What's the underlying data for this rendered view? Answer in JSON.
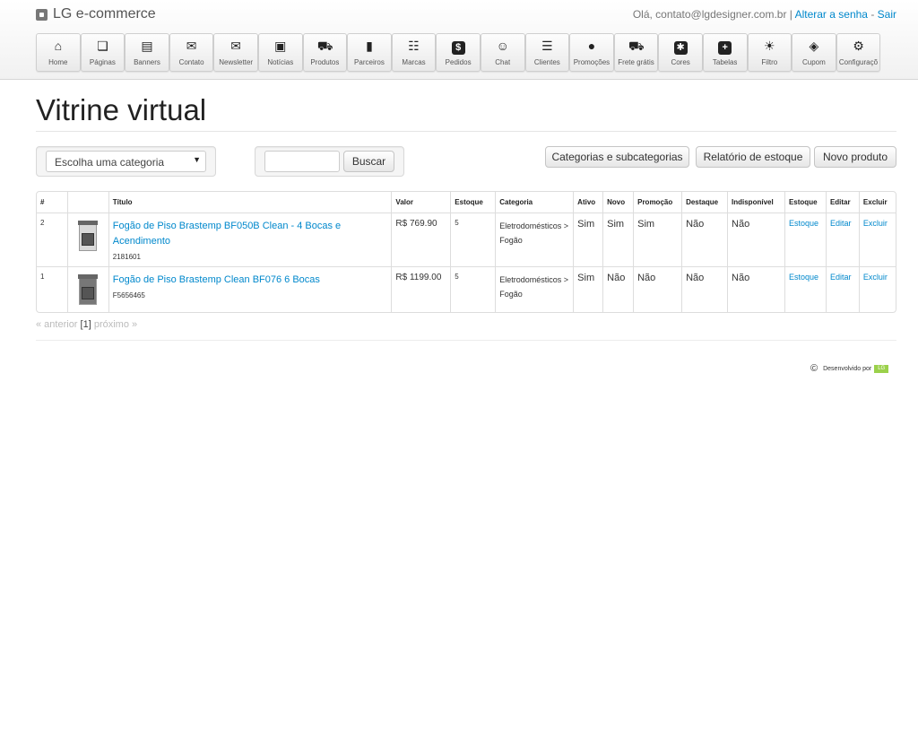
{
  "header": {
    "brand": "LG e-commerce",
    "greeting": "Olá, contato@lgdesigner.com.br |",
    "change_password": "Alterar a senha",
    "separator": "-",
    "logout": "Sair"
  },
  "nav": [
    {
      "label": "Home",
      "icon": "home-icon"
    },
    {
      "label": "Páginas",
      "icon": "pages-icon"
    },
    {
      "label": "Banners",
      "icon": "banner-icon"
    },
    {
      "label": "Contato",
      "icon": "mail-icon"
    },
    {
      "label": "Newsletter",
      "icon": "send-mail-icon"
    },
    {
      "label": "Notícias",
      "icon": "news-icon"
    },
    {
      "label": "Produtos",
      "icon": "cart-icon"
    },
    {
      "label": "Parceiros",
      "icon": "chart-icon"
    },
    {
      "label": "Marcas",
      "icon": "sitemap-icon"
    },
    {
      "label": "Pedidos",
      "icon": "dollar-icon"
    },
    {
      "label": "Chat",
      "icon": "chat-icon"
    },
    {
      "label": "Clientes",
      "icon": "database-icon"
    },
    {
      "label": "Promoções",
      "icon": "money-bag-icon"
    },
    {
      "label": "Frete grátis",
      "icon": "cart-icon"
    },
    {
      "label": "Cores",
      "icon": "palette-icon"
    },
    {
      "label": "Tabelas",
      "icon": "plus-box-icon"
    },
    {
      "label": "Filtro",
      "icon": "sun-icon"
    },
    {
      "label": "Cupom",
      "icon": "tag-icon"
    },
    {
      "label": "Configuraçõ",
      "icon": "gear-icon"
    }
  ],
  "page": {
    "title": "Vitrine virtual"
  },
  "filters": {
    "category_select": "Escolha uma categoria",
    "search_button": "Buscar",
    "search_value": ""
  },
  "actions": {
    "categories": "Categorias e subcategorias",
    "stock_report": "Relatório de estoque",
    "new_product": "Novo produto"
  },
  "table": {
    "headers": [
      "#",
      "",
      "Título",
      "Valor",
      "Estoque",
      "Categoria",
      "Ativo",
      "Novo",
      "Promoção",
      "Destaque",
      "Indisponível",
      "Estoque",
      "Editar",
      "Excluir"
    ],
    "rows": [
      {
        "id": "2",
        "title": "Fogão de Piso Brastemp BF050B Clean - 4 Bocas e Acendimento",
        "code": "2181601",
        "value": "R$ 769.90",
        "stock": "5",
        "category": "Eletrodomésticos > Fogão",
        "active": "Sim",
        "new": "Sim",
        "promo": "Sim",
        "featured": "Não",
        "unavailable": "Não",
        "stock_link": "Estoque",
        "edit_link": "Editar",
        "delete_link": "Excluir"
      },
      {
        "id": "1",
        "title": "Fogão de Piso Brastemp Clean BF076 6 Bocas",
        "code": "F5656465",
        "value": "R$ 1199.00",
        "stock": "5",
        "category": "Eletrodomésticos > Fogão",
        "active": "Sim",
        "new": "Não",
        "promo": "Não",
        "featured": "Não",
        "unavailable": "Não",
        "stock_link": "Estoque",
        "edit_link": "Editar",
        "delete_link": "Excluir"
      }
    ]
  },
  "pagination": {
    "prev": "« anterior",
    "current": "[1]",
    "next": "próximo »"
  },
  "footer": {
    "copyright": "©",
    "text": "Desenvolvido por",
    "logo": "LG"
  }
}
